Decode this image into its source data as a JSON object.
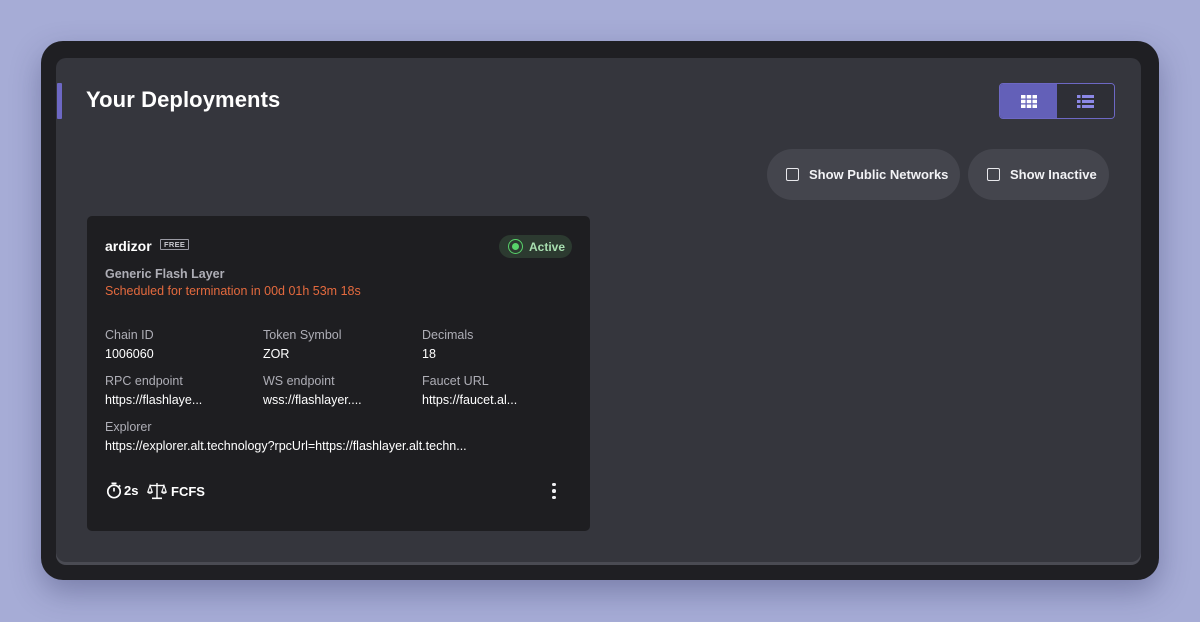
{
  "page": {
    "title": "Your Deployments"
  },
  "view_toggle": {
    "options": [
      "grid-view",
      "list-view"
    ],
    "selected": "grid-view"
  },
  "filters": [
    {
      "label": "Show Public Networks",
      "checked": false
    },
    {
      "label": "Show Inactive",
      "checked": false
    }
  ],
  "deployment": {
    "name": "ardizor",
    "plan": "FREE",
    "status": "Active",
    "type": "Generic Flash Layer",
    "termination": "Scheduled for termination in 00d 01h 53m 18s",
    "fields": {
      "chain_id": {
        "label": "Chain ID",
        "value": "1006060"
      },
      "token_symbol": {
        "label": "Token Symbol",
        "value": "ZOR"
      },
      "decimals": {
        "label": "Decimals",
        "value": "18"
      },
      "rpc": {
        "label": "RPC endpoint",
        "value": "https://flashlaye..."
      },
      "ws": {
        "label": "WS endpoint",
        "value": "wss://flashlayer...."
      },
      "faucet": {
        "label": "Faucet URL",
        "value": "https://faucet.al..."
      },
      "explorer": {
        "label": "Explorer",
        "value": "https://explorer.alt.technology?rpcUrl=https://flashlayer.alt.techn..."
      }
    },
    "block_time": "2s",
    "sequencer": "FCFS"
  },
  "colors": {
    "accent": "#6360b8",
    "active_green": "#58d36a",
    "warning_orange": "#e46a3e",
    "card_bg": "#1e1e21",
    "panel_bg": "#35363d"
  },
  "icons": {
    "grid": "grid-view-icon",
    "list": "list-view-icon",
    "status": "status-dot-icon",
    "block_time": "stopwatch-icon",
    "sequencer": "balance-scale-icon",
    "more": "more-vertical-icon"
  }
}
